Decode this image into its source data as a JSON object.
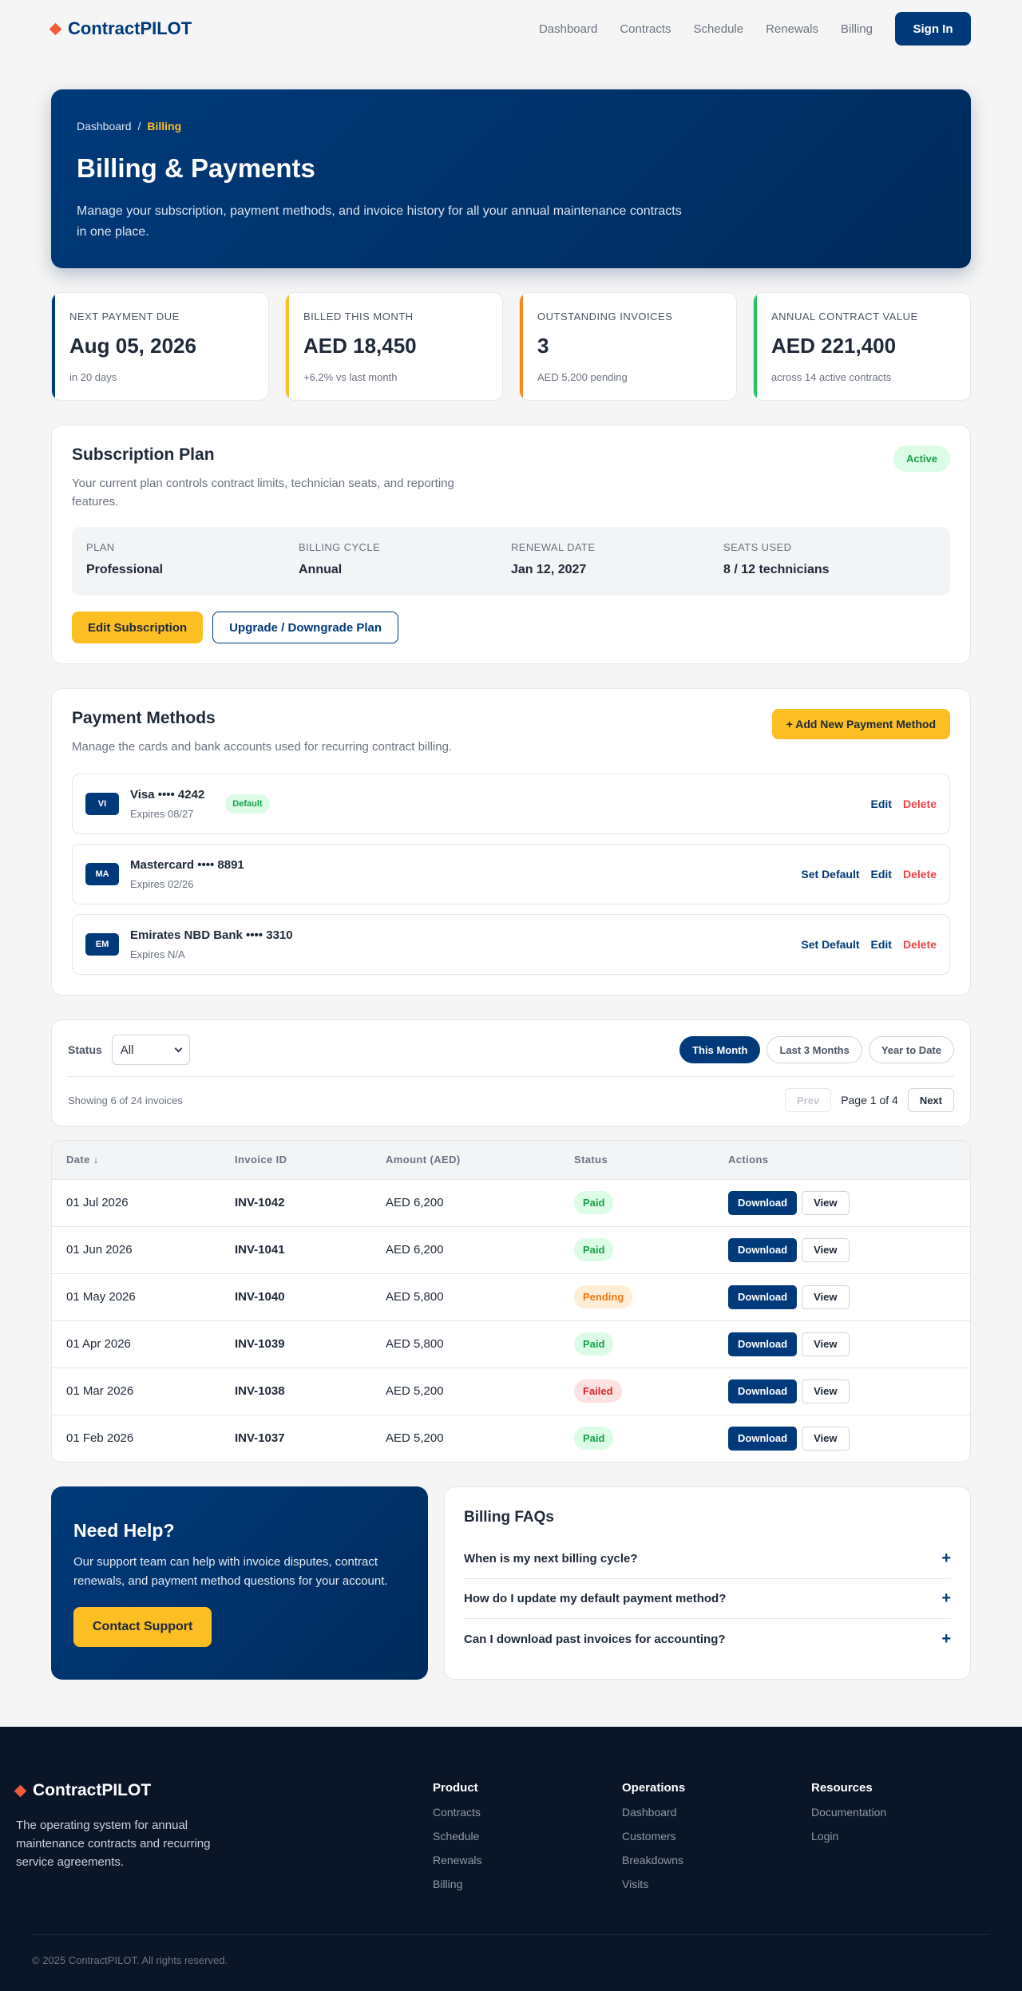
{
  "header": {
    "brand": "ContractPILOT",
    "nav": [
      "Dashboard",
      "Contracts",
      "Schedule",
      "Renewals",
      "Billing"
    ],
    "signin_label": "Sign In"
  },
  "hero": {
    "breadcrumb_home": "Dashboard",
    "breadcrumb_sep": "/",
    "breadcrumb_current": "Billing",
    "title": "Billing & Payments",
    "description": "Manage your subscription, payment methods, and invoice history for all your annual maintenance contracts in one place."
  },
  "stats": [
    {
      "label": "Next Payment Due",
      "value": "Aug 05, 2026",
      "sub": "in 20 days"
    },
    {
      "label": "Billed This Month",
      "value": "AED 18,450",
      "sub": "+6.2% vs last month"
    },
    {
      "label": "Outstanding Invoices",
      "value": "3",
      "sub": "AED 5,200 pending"
    },
    {
      "label": "Annual Contract Value",
      "value": "AED 221,400",
      "sub": "across 14 active contracts"
    }
  ],
  "subscription": {
    "title": "Subscription Plan",
    "description": "Your current plan controls contract limits, technician seats, and reporting features.",
    "status_badge": "Active",
    "fields": [
      {
        "label": "Plan",
        "value": "Professional"
      },
      {
        "label": "Billing Cycle",
        "value": "Annual"
      },
      {
        "label": "Renewal Date",
        "value": "Jan 12, 2027"
      },
      {
        "label": "Seats Used",
        "value": "8 / 12 technicians"
      }
    ],
    "edit_label": "Edit Subscription",
    "upgrade_label": "Upgrade / Downgrade Plan"
  },
  "payment_methods": {
    "title": "Payment Methods",
    "description": "Manage the cards and bank accounts used for recurring contract billing.",
    "add_label": "+ Add New Payment Method",
    "default_badge": "Default",
    "set_default_label": "Set Default",
    "edit_label": "Edit",
    "delete_label": "Delete",
    "items": [
      {
        "brand": "VI",
        "name": "Visa •••• 4242",
        "expires": "Expires 08/27"
      },
      {
        "brand": "MA",
        "name": "Mastercard •••• 8891",
        "expires": "Expires 02/26"
      },
      {
        "brand": "EM",
        "name": "Emirates NBD Bank •••• 3310",
        "expires": "Expires N/A"
      }
    ]
  },
  "filters": {
    "status_label": "Status",
    "status_value": "All",
    "periods": [
      "This Month",
      "Last 3 Months",
      "Year to Date"
    ],
    "showing": "Showing 6 of 24 invoices",
    "prev_label": "Prev",
    "page_text": "Page 1 of 4",
    "next_label": "Next"
  },
  "invoices": {
    "columns": [
      "Date ↓",
      "Invoice ID",
      "Amount (AED)",
      "Status",
      "Actions"
    ],
    "download_label": "Download",
    "view_label": "View",
    "rows": [
      {
        "date": "01 Jul 2026",
        "id": "INV-1042",
        "amount": "AED 6,200",
        "status": "Paid"
      },
      {
        "date": "01 Jun 2026",
        "id": "INV-1041",
        "amount": "AED 6,200",
        "status": "Paid"
      },
      {
        "date": "01 May 2026",
        "id": "INV-1040",
        "amount": "AED 5,800",
        "status": "Pending"
      },
      {
        "date": "01 Apr 2026",
        "id": "INV-1039",
        "amount": "AED 5,800",
        "status": "Paid"
      },
      {
        "date": "01 Mar 2026",
        "id": "INV-1038",
        "amount": "AED 5,200",
        "status": "Failed"
      },
      {
        "date": "01 Feb 2026",
        "id": "INV-1037",
        "amount": "AED 5,200",
        "status": "Paid"
      }
    ]
  },
  "help": {
    "title": "Need Help?",
    "description": "Our support team can help with invoice disputes, contract renewals, and payment method questions for your account.",
    "button_label": "Contact Support"
  },
  "faq": {
    "title": "Billing FAQs",
    "items": [
      "When is my next billing cycle?",
      "How do I update my default payment method?",
      "Can I download past invoices for accounting?"
    ]
  },
  "footer": {
    "brand": "ContractPILOT",
    "description": "The operating system for annual maintenance contracts and recurring service agreements.",
    "columns": [
      {
        "title": "Product",
        "links": [
          "Contracts",
          "Schedule",
          "Renewals",
          "Billing"
        ]
      },
      {
        "title": "Operations",
        "links": [
          "Dashboard",
          "Customers",
          "Breakdowns",
          "Visits"
        ]
      },
      {
        "title": "Resources",
        "links": [
          "Documentation",
          "Login"
        ]
      }
    ],
    "copyright": "© 2025 ContractPILOT. All rights reserved."
  },
  "colors": {
    "primary": "#003a7a",
    "accent": "#fbbf24",
    "danger": "#ef4444",
    "success": "#16a34a",
    "footer_bg": "#0a1628"
  }
}
